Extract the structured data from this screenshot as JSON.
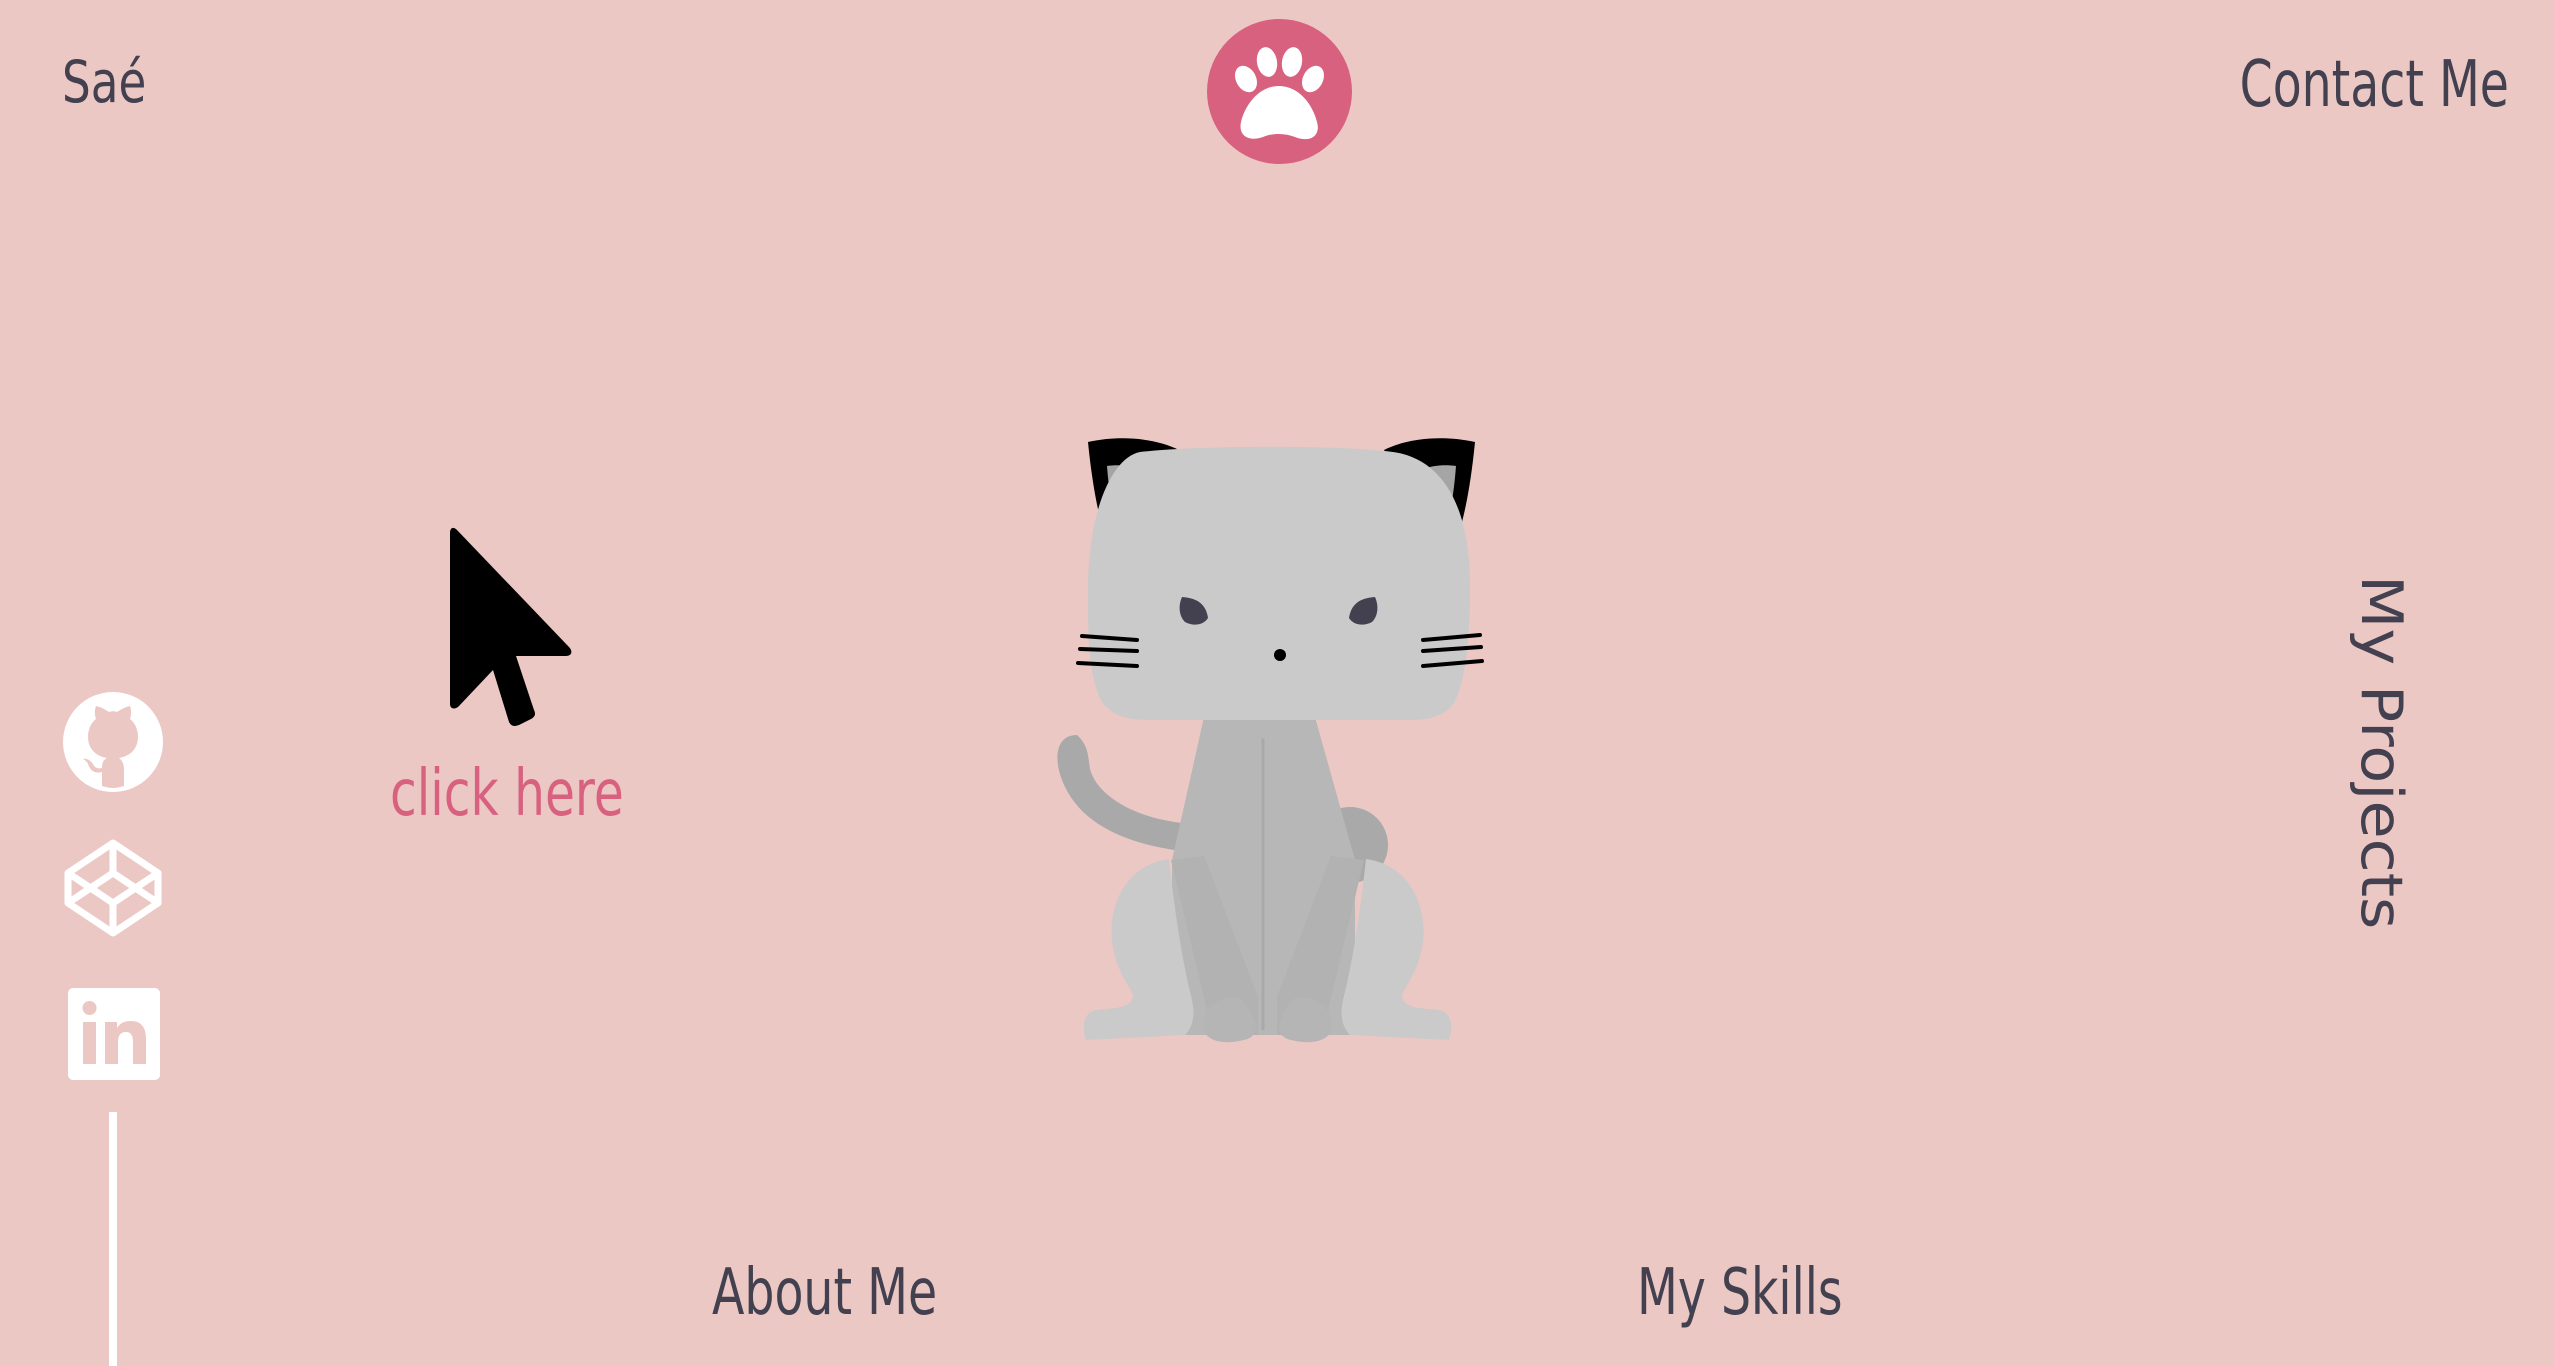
{
  "brand": {
    "name": "Saé",
    "accent_color": "#d7617f",
    "background_color": "#ecc8c4",
    "text_color": "#43404f"
  },
  "navigation": {
    "contact_label": "Contact Me",
    "projects_label": "My Projects",
    "about_label": "About Me",
    "skills_label": "My Skills"
  },
  "hero": {
    "cursor_hint_label": "click here",
    "cursor_icon": "mouse-pointer-icon",
    "center_icon": "paw-icon",
    "illustration": "cat-illustration"
  },
  "social": [
    {
      "name": "github-icon"
    },
    {
      "name": "codepen-icon"
    },
    {
      "name": "linkedin-icon"
    }
  ]
}
